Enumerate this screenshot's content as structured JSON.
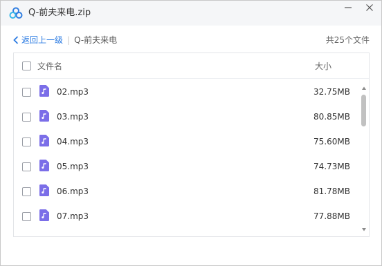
{
  "window": {
    "title": "Q-前夫来电.zip",
    "app_icon": "baidu-netdisk-cloud-icon"
  },
  "breadcrumb": {
    "back_label": "返回上一级",
    "separator": "|",
    "current": "Q-前夫来电"
  },
  "file_count": "共25个文件",
  "list": {
    "columns": {
      "name": "文件名",
      "size": "大小"
    },
    "rows": [
      {
        "name": "02.mp3",
        "size": "32.75MB"
      },
      {
        "name": "03.mp3",
        "size": "80.85MB"
      },
      {
        "name": "04.mp3",
        "size": "75.60MB"
      },
      {
        "name": "05.mp3",
        "size": "74.73MB"
      },
      {
        "name": "06.mp3",
        "size": "81.78MB"
      },
      {
        "name": "07.mp3",
        "size": "77.88MB"
      }
    ]
  },
  "colors": {
    "link": "#2a7ae2",
    "audio_icon": "#7b6ee8",
    "titlebar_bg": "#f5f6f8"
  }
}
